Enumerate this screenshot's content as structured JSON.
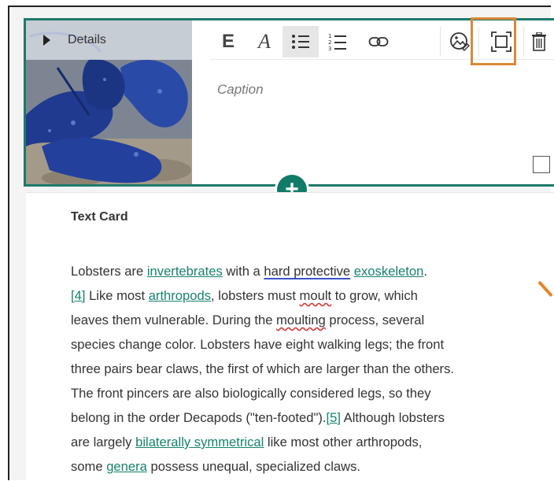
{
  "image_card": {
    "details_label": "Details",
    "caption_placeholder": "Caption",
    "toolbar": {
      "heading_label": "E",
      "italic_label": "A"
    }
  },
  "add_button_label": "+",
  "text_card": {
    "title": "Text Card",
    "lines": [
      [
        "Lobsters are ",
        "invertebrates",
        " with a ",
        "hard protective",
        " ",
        "exoskeleton",
        "."
      ],
      [
        "[4]",
        " Like most ",
        "arthropods",
        ", lobsters must ",
        "moult",
        " to grow, which"
      ],
      [
        "leaves them vulnerable. During the ",
        "moulting",
        " process, several"
      ],
      [
        "species change color. Lobsters have eight walking legs; the front"
      ],
      [
        "three pairs bear claws, the first of which are larger than the others."
      ],
      [
        "The front pincers are also biologically considered legs, so they"
      ],
      [
        "belong in the order Decapods (\"ten-footed\").",
        "[5]",
        " Although lobsters"
      ],
      [
        "are largely ",
        "bilaterally symmetrical",
        " like most other arthropods,"
      ],
      [
        "some ",
        "genera",
        " possess unequal, specialized claws."
      ]
    ]
  },
  "colors": {
    "accent": "#127a68",
    "link": "#17826f",
    "highlight": "#d8893a"
  },
  "icons": [
    "expand-triangle-icon",
    "heading-icon",
    "italic-icon",
    "bullet-list-icon",
    "numbered-list-icon",
    "link-icon",
    "image-edit-icon",
    "fullscreen-icon",
    "trash-icon",
    "plus-icon"
  ]
}
